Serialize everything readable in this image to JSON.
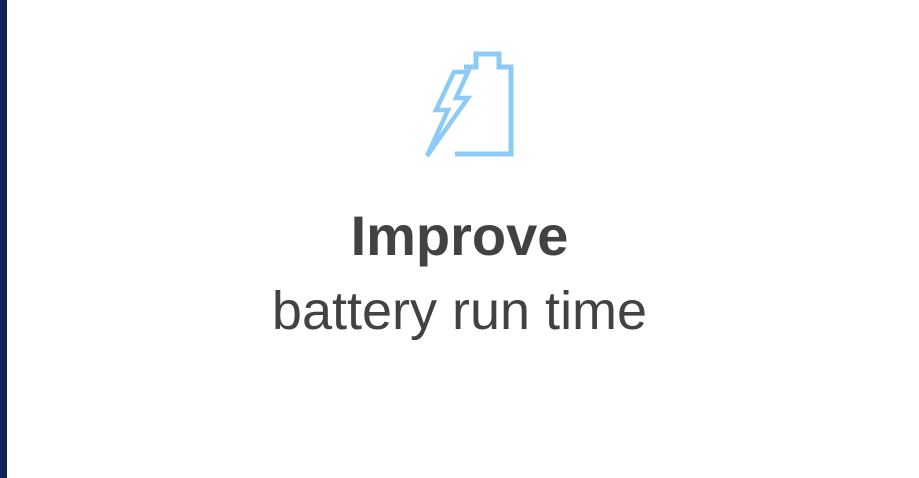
{
  "colors": {
    "edge": "#0d2559",
    "icon": "#8bcbf5",
    "text": "#424242",
    "background": "#ffffff"
  },
  "feature": {
    "icon": "battery-charging-icon",
    "title": "Improve",
    "subtitle": "battery run time"
  }
}
